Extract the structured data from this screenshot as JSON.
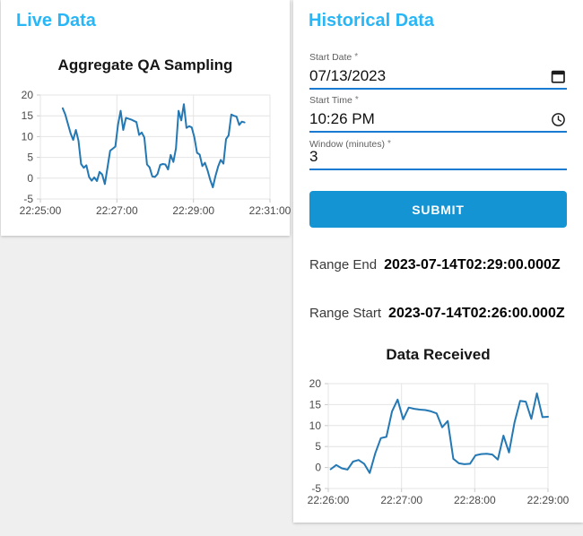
{
  "colors": {
    "page_bg": "#efefef",
    "card_bg": "#ffffff",
    "heading": "#29b6f6",
    "button_bg": "#1494d3",
    "underline": "#187bd1",
    "line": "#2478b4"
  },
  "live_panel": {
    "title": "Live Data"
  },
  "historical_panel": {
    "title": "Historical Data",
    "fields": [
      {
        "label": "Start Date",
        "required": "*",
        "value": "07/13/2023",
        "icon": "calendar-icon"
      },
      {
        "label": "Start Time",
        "required": "*",
        "value": "10:26 PM",
        "icon": "clock-icon"
      },
      {
        "label": "Window (minutes)",
        "required": "*",
        "value": "3",
        "icon": ""
      }
    ],
    "submit_label": "SUBMIT",
    "results": [
      {
        "label": "Range End",
        "value": "2023-07-14T02:29:00.000Z"
      },
      {
        "label": "Range Start",
        "value": "2023-07-14T02:26:00.000Z"
      }
    ]
  },
  "chart_data": [
    {
      "type": "line",
      "title": "Aggregate QA Sampling",
      "xlabel": "",
      "ylabel": "",
      "ylim": [
        -5,
        20
      ],
      "y_ticks": [
        20,
        15,
        10,
        5,
        0,
        -5
      ],
      "x_tick_labels": [
        "22:25:00",
        "22:27:00",
        "22:29:00",
        "22:31:00"
      ],
      "x_range_seconds": [
        0,
        360
      ],
      "grid": true,
      "legend": false,
      "line_color": "#2478b4",
      "series": [
        {
          "name": "Aggregate QA Sampling",
          "t_start_seconds": 35,
          "t_end_seconds": 320,
          "values": [
            16.8,
            15.3,
            13.0,
            10.8,
            9.2,
            11.6,
            9.0,
            3.4,
            2.5,
            3.1,
            0.3,
            -0.6,
            0.2,
            -0.7,
            1.5,
            0.9,
            -1.4,
            2.5,
            6.6,
            7.1,
            7.6,
            12.9,
            16.2,
            11.6,
            14.5,
            14.3,
            14.1,
            13.8,
            13.5,
            10.4,
            11.0,
            9.8,
            3.3,
            2.6,
            0.4,
            0.3,
            1.0,
            3.2,
            3.4,
            3.3,
            2.1,
            5.6,
            3.9,
            7.2,
            16.2,
            13.9,
            17.8,
            12.1,
            12.5,
            12.2,
            9.8,
            6.1,
            5.7,
            2.9,
            3.7,
            1.9,
            -0.4,
            -2.2,
            0.5,
            2.8,
            4.4,
            3.5,
            9.4,
            10.3,
            15.3,
            15.0,
            14.8,
            12.8,
            13.6,
            13.4
          ]
        }
      ]
    },
    {
      "type": "line",
      "title": "Data Received",
      "xlabel": "",
      "ylabel": "",
      "ylim": [
        -5,
        20
      ],
      "y_ticks": [
        20,
        15,
        10,
        5,
        0,
        -5
      ],
      "x_tick_labels": [
        "22:26:00",
        "22:27:00",
        "22:28:00",
        "22:29:00"
      ],
      "x_range_seconds": [
        0,
        180
      ],
      "grid": true,
      "legend": false,
      "line_color": "#2478b4",
      "series": [
        {
          "name": "Data Received",
          "t_start_seconds": 2,
          "t_end_seconds": 180,
          "values": [
            -0.4,
            0.6,
            -0.2,
            -0.5,
            1.4,
            1.8,
            0.9,
            -1.3,
            3.4,
            7.0,
            7.3,
            13.4,
            16.2,
            11.5,
            14.3,
            14.0,
            13.8,
            13.7,
            13.4,
            12.9,
            9.6,
            11.1,
            2.1,
            1.0,
            0.8,
            0.9,
            2.9,
            3.2,
            3.3,
            3.1,
            1.9,
            7.6,
            3.6,
            10.8,
            15.9,
            15.7,
            11.6,
            17.7,
            12.0,
            12.1
          ]
        }
      ]
    }
  ]
}
